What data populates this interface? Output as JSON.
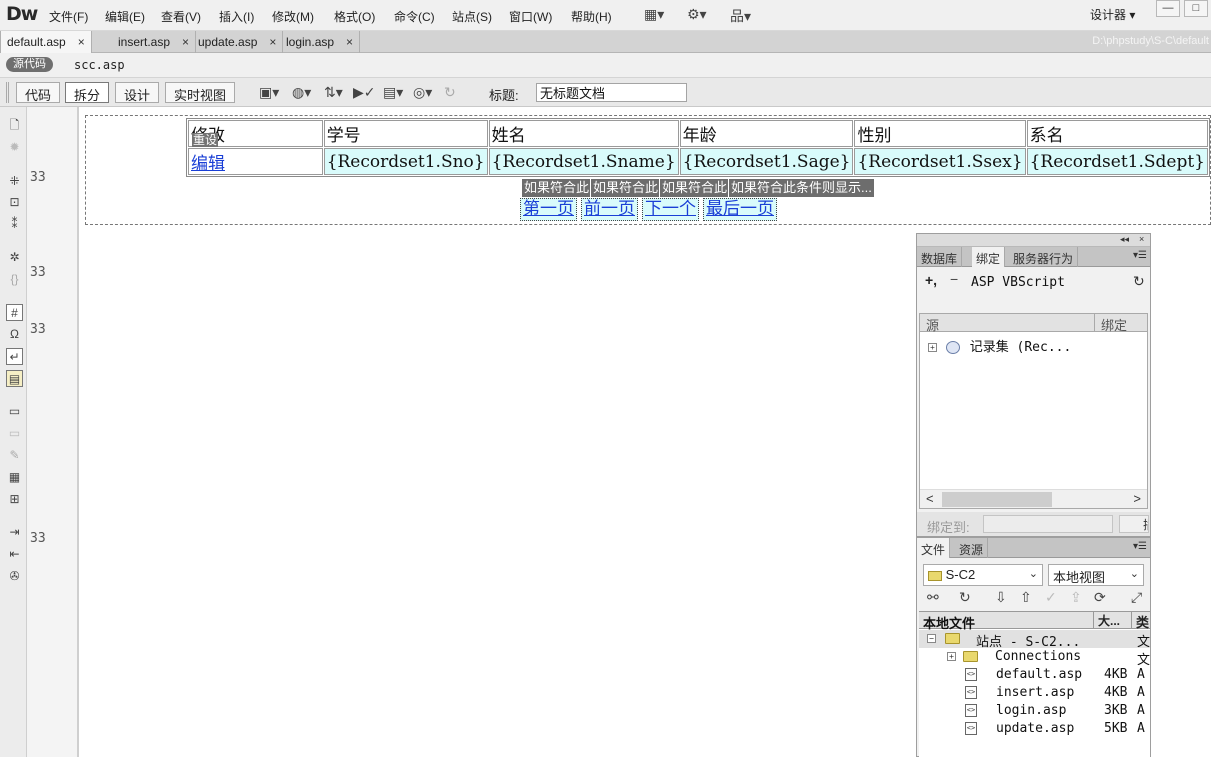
{
  "app": {
    "logo": "Dw"
  },
  "menu": [
    "文件(F)",
    "编辑(E)",
    "查看(V)",
    "插入(I)",
    "修改(M)",
    "格式(O)",
    "命令(C)",
    "站点(S)",
    "窗口(W)",
    "帮助(H)"
  ],
  "toolbar_icons": {
    "layout": "▦▾",
    "extend": "⚙▾",
    "site": "品▾"
  },
  "workspace": {
    "label": "设计器 ▾"
  },
  "window_buttons": {
    "minimize": "—",
    "maximize": "□"
  },
  "tabs": [
    {
      "label": "default.asp",
      "close": "×",
      "active": true
    },
    {
      "label": "insert.asp",
      "close": "×"
    },
    {
      "label": "update.asp",
      "close": "×"
    },
    {
      "label": "login.asp",
      "close": "×"
    }
  ],
  "file_path": "D:\\phpstudy\\S-C\\default",
  "related": {
    "source": "源代码",
    "file": "scc.asp"
  },
  "views": {
    "code": "代码",
    "split": "拆分",
    "design": "设计",
    "live": "实时视图"
  },
  "title_field": {
    "label": "标题:",
    "value": "无标题文档"
  },
  "code": {
    "line_numbers": [
      "33",
      "33",
      "33",
      "33"
    ],
    "scroll_up": "︿",
    "scroll_down": "﹀"
  },
  "design": {
    "headers": [
      "修改",
      "学号",
      "姓名",
      "年龄",
      "性别",
      "系名"
    ],
    "reset_label": "重设",
    "row": {
      "edit_link": "编辑",
      "cells": [
        "{Recordset1.Sno}",
        "{Recordset1.Sname}",
        "{Recordset1.Sage}",
        "{Recordset1.Ssex}",
        "{Recordset1.Sdept}"
      ]
    },
    "conditions": [
      "如果符合此",
      "如果符合此",
      "如果符合此",
      "如果符合此条件则显示..."
    ],
    "nav_links": [
      "第一页",
      "前一页",
      "下一个",
      "最后一页"
    ]
  },
  "bindings_panel": {
    "header_buttons": {
      "collapse": "◂◂",
      "close": "×"
    },
    "tabs": [
      "数据库",
      "绑定",
      "服务器行为"
    ],
    "active_tab": 1,
    "menu": "▾☰",
    "add": "+,",
    "remove": "−",
    "language": "ASP VBScript",
    "refresh": "↻",
    "col_source": "源",
    "col_binding": "绑定",
    "expander": "+",
    "recordset_label": "记录集 (Rec...",
    "scroll_left": "<",
    "scroll_right": ">",
    "bind_to_label": "绑定到:",
    "bind_to_button": "插"
  },
  "files_panel": {
    "tabs": [
      "文件",
      "资源"
    ],
    "active_tab": 0,
    "menu": "▾☰",
    "site": "S-C2",
    "view": "本地视图",
    "select_arrow": "⌄",
    "toolbar": [
      "⚯",
      "↻",
      "⇩",
      "⇧",
      "✓",
      "⇪",
      "⟳",
      "⤢"
    ],
    "col_local": "本地文件",
    "col_size": "大...",
    "col_type": "类",
    "site_node": {
      "expander": "−",
      "label": "站点 - S-C2...",
      "type": "文"
    },
    "folder_node": {
      "expander": "+",
      "label": "Connections",
      "type": "文"
    },
    "files": [
      {
        "name": "default.asp",
        "size": "4KB",
        "type": "A"
      },
      {
        "name": "insert.asp",
        "size": "4KB",
        "type": "A"
      },
      {
        "name": "login.asp",
        "size": "3KB",
        "type": "A"
      },
      {
        "name": "update.asp",
        "size": "5KB",
        "type": "A"
      }
    ],
    "file_icon": "&lt;&gt;"
  },
  "colors": {
    "bound_cell": "#d9fbfb",
    "link": "#1a3fd6",
    "label_gray": "#6d6d6d"
  }
}
